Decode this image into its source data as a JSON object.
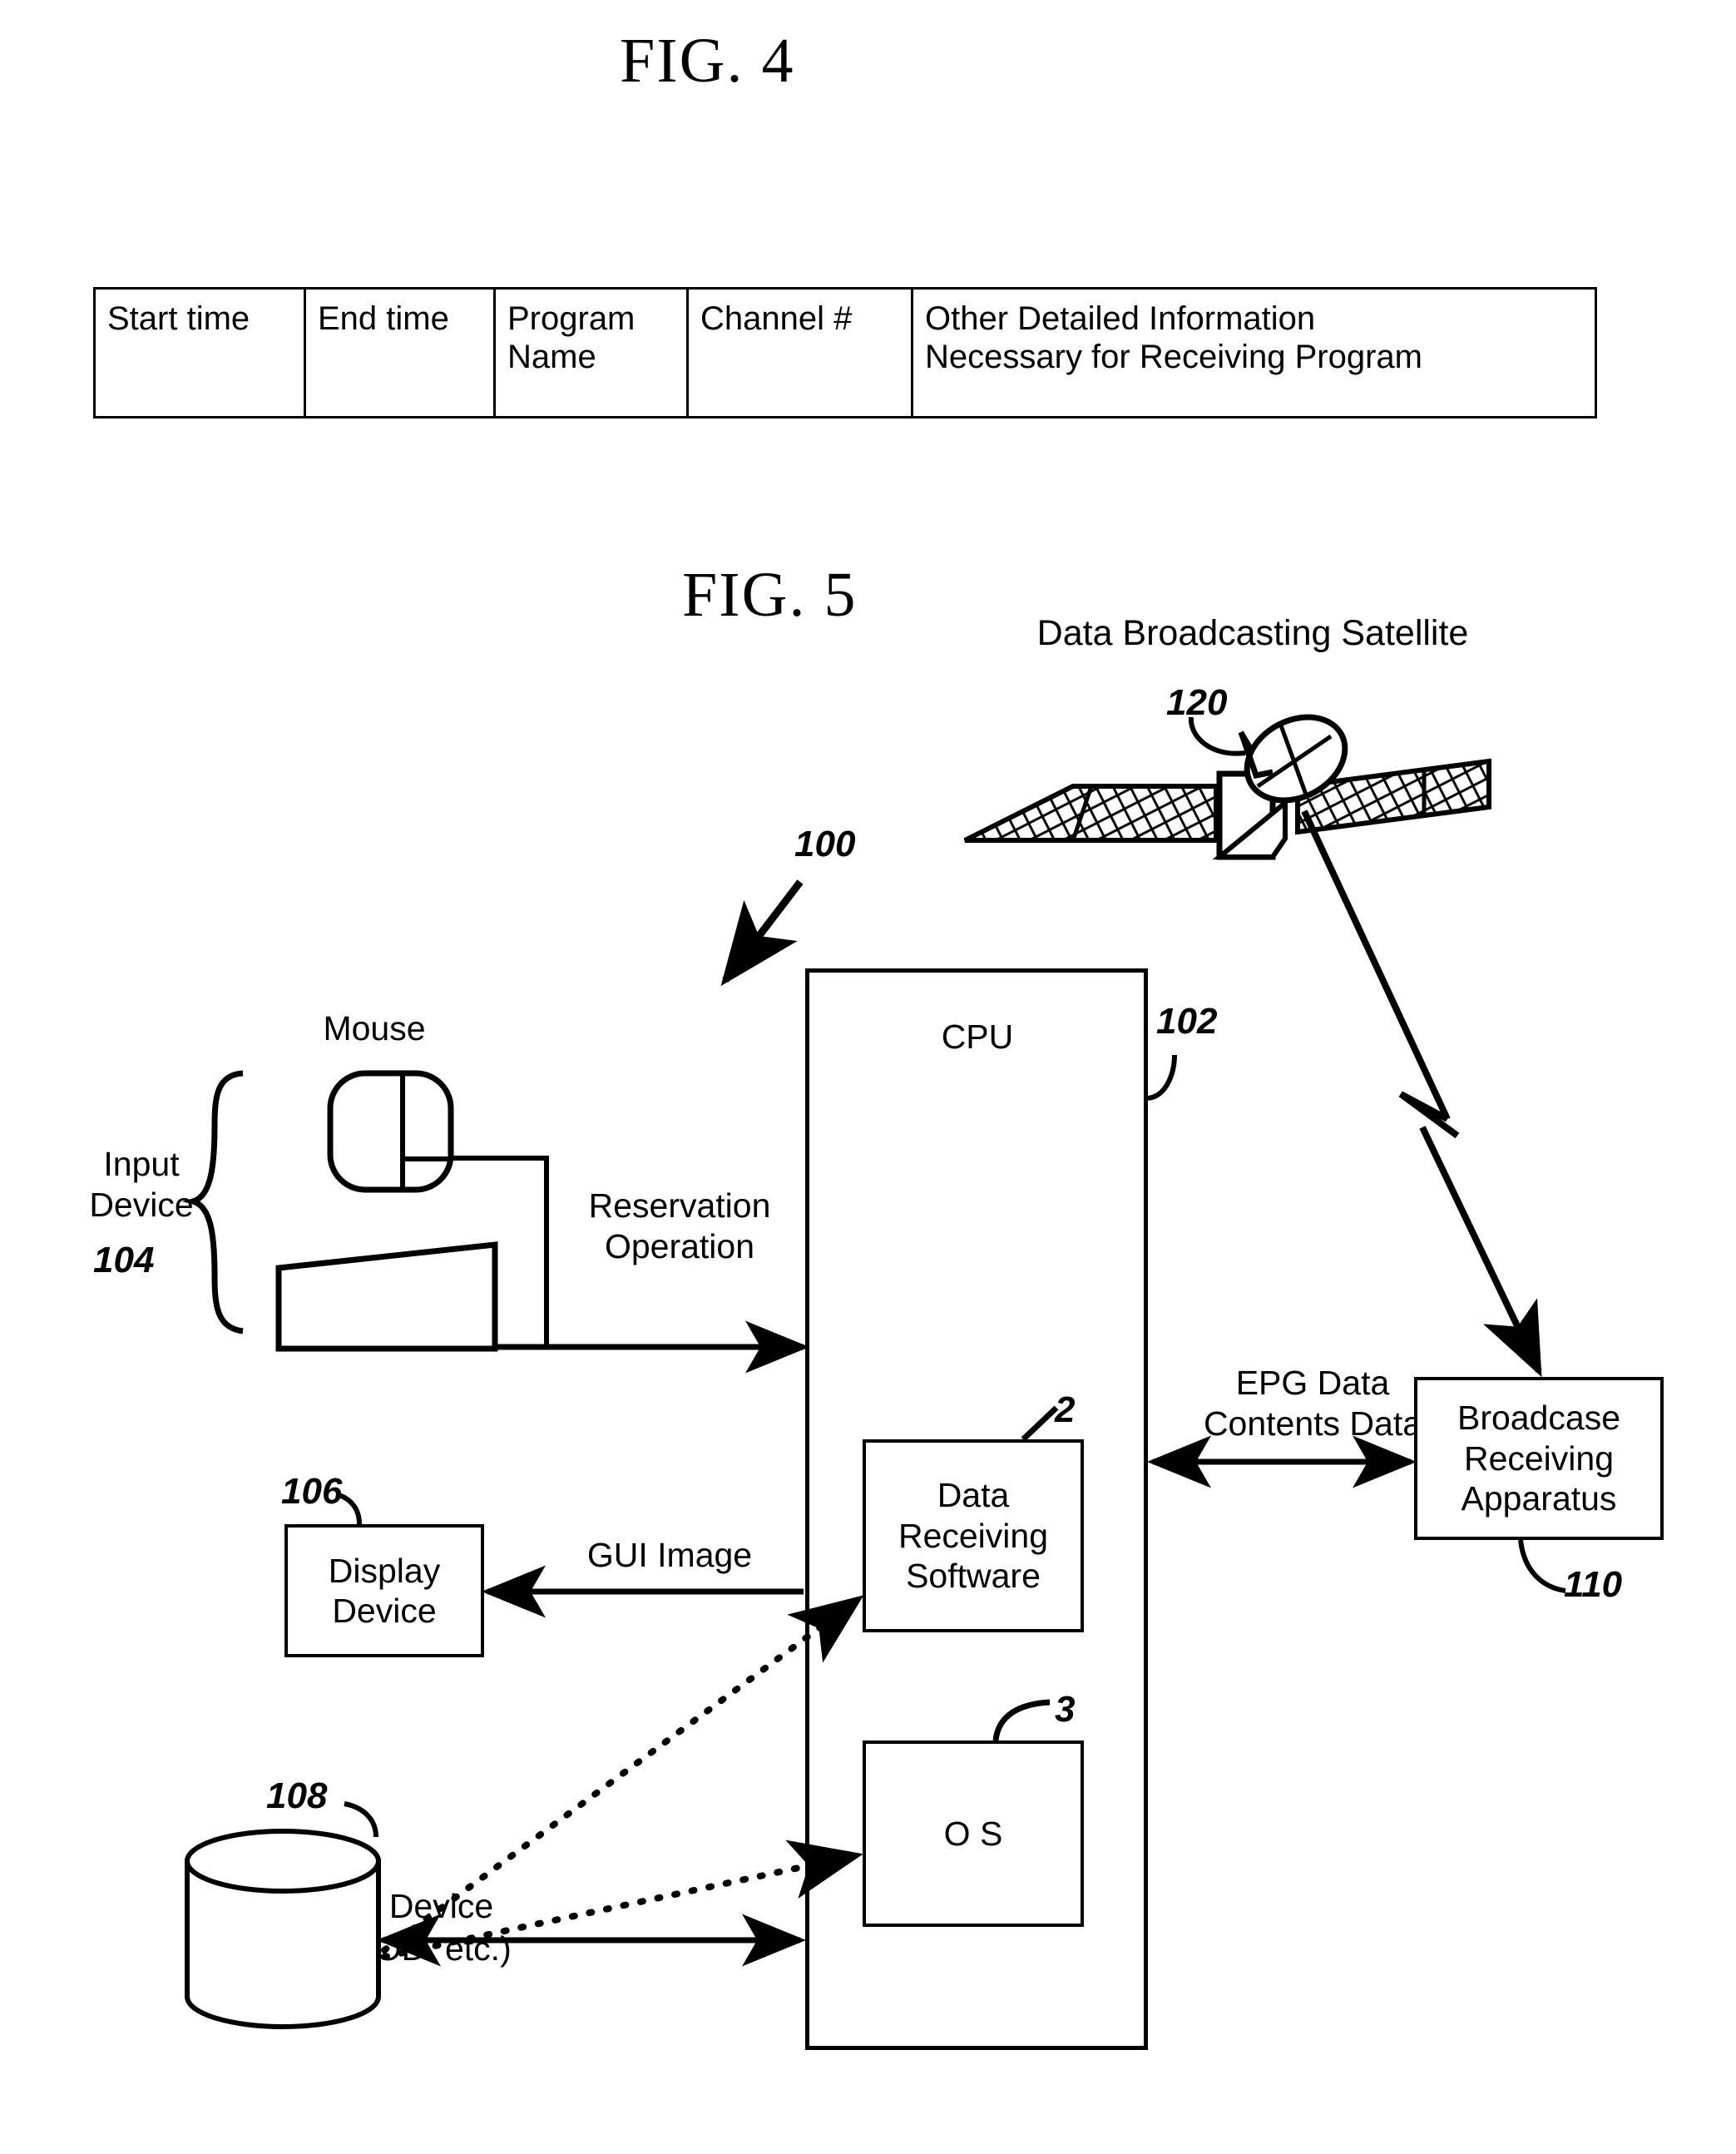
{
  "figures": {
    "fig4": {
      "title": "FIG. 4",
      "table": {
        "headers": [
          "Start time",
          "End time",
          "Program\nName",
          "Channel #",
          "Other Detailed Information\nNecessary for Receiving Program"
        ]
      }
    },
    "fig5": {
      "title": "FIG. 5",
      "satellite": {
        "label": "Data Broadcasting Satellite",
        "ref": "120"
      },
      "system": {
        "ref": "100"
      },
      "cpu": {
        "label": "CPU",
        "ref": "102"
      },
      "data_receiving_software": {
        "label": "Data\nReceiving\nSoftware",
        "ref": "2"
      },
      "os": {
        "label": "O S",
        "ref": "3"
      },
      "input_device": {
        "label": "Input\nDevice",
        "ref": "104"
      },
      "mouse": {
        "label": "Mouse"
      },
      "keyboard": {
        "label": "Keyboard"
      },
      "display_device": {
        "label": "Display\nDevice",
        "ref": "106"
      },
      "storage_device": {
        "label": "Storage Device\n(HDD. MOD. etc.)",
        "ref": "108"
      },
      "broadcast_receiving_apparatus": {
        "label": "Broadcase\nReceiving\nApparatus",
        "ref": "110"
      },
      "arrows": {
        "reservation_operation": "Reservation\nOperation",
        "gui_image": "GUI Image",
        "epg_contents": "EPG Data\nContents Data"
      }
    }
  }
}
